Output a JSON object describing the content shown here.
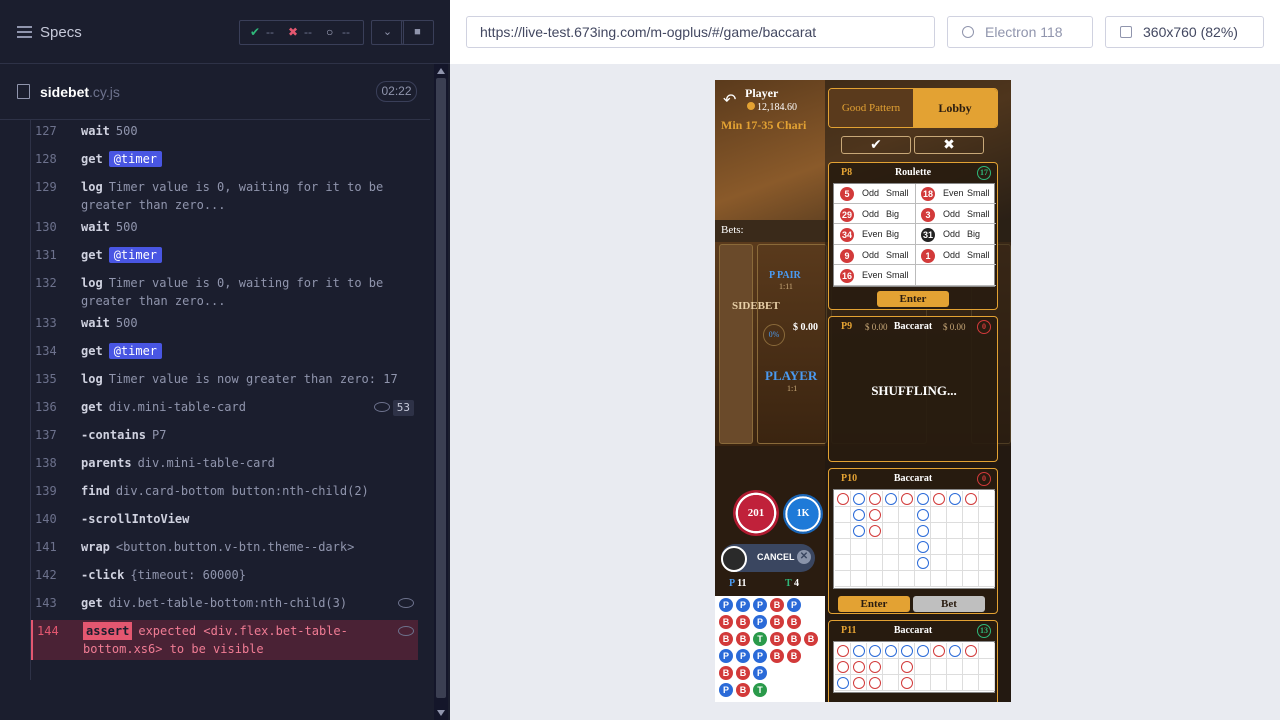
{
  "runner": {
    "specs_label": "Specs",
    "stats": {
      "passed": "--",
      "failed": "--",
      "pending": "--"
    },
    "file": {
      "name": "sidebet",
      "ext": ".cy.js",
      "duration": "02:22"
    },
    "commands": [
      {
        "num": "127",
        "name": "wait",
        "arg": "500"
      },
      {
        "num": "128",
        "name": "get",
        "alias": "@timer"
      },
      {
        "num": "129",
        "name": "log",
        "arg": "Timer value is 0, waiting for it to be greater than zero..."
      },
      {
        "num": "130",
        "name": "wait",
        "arg": "500"
      },
      {
        "num": "131",
        "name": "get",
        "alias": "@timer"
      },
      {
        "num": "132",
        "name": "log",
        "arg": "Timer value is 0, waiting for it to be greater than zero..."
      },
      {
        "num": "133",
        "name": "wait",
        "arg": "500"
      },
      {
        "num": "134",
        "name": "get",
        "alias": "@timer"
      },
      {
        "num": "135",
        "name": "log",
        "arg": "Timer value is now greater than zero: 17"
      },
      {
        "num": "136",
        "name": "get",
        "arg": "div.mini-table-card",
        "count": "53"
      },
      {
        "num": "137",
        "name": "-contains",
        "arg": "P7"
      },
      {
        "num": "138",
        "name": "parents",
        "arg": "div.mini-table-card"
      },
      {
        "num": "139",
        "name": "find",
        "arg": "div.card-bottom button:nth-child(2)"
      },
      {
        "num": "140",
        "name": "-scrollIntoView",
        "arg": ""
      },
      {
        "num": "141",
        "name": "wrap",
        "arg": "<button.button.v-btn.theme--dark>"
      },
      {
        "num": "142",
        "name": "-click",
        "arg": "{timeout: 60000}"
      },
      {
        "num": "143",
        "name": "get",
        "arg": "div.bet-table-bottom:nth-child(3)"
      }
    ],
    "error": {
      "num": "144",
      "badge": "assert",
      "message": "expected <div.flex.bet-table-bottom.xs6> to be visible"
    }
  },
  "browser": {
    "url": "https://live-test.673ing.com/m-ogplus/#/game/baccarat",
    "name": "Electron 118",
    "viewport": "360x760",
    "zoom": "(82%)"
  },
  "game": {
    "player_name": "Player",
    "balance": "12,184.60",
    "min_max": "Min 17-35 Chari",
    "bets_label": "Bets:",
    "sidebet_label": "SIDEBET",
    "ppair": "P PAIR",
    "ppair_odds": "1:11",
    "player_chip": "0%",
    "player_amount": "$ 0.00",
    "player_label": "PLAYER",
    "player_odds": "1:1",
    "chip1": "201",
    "chip2": "1K",
    "cancel": "CANCEL",
    "stats": {
      "p_label": "P",
      "p_count": "11",
      "t_label": "T",
      "t_count": "4"
    },
    "tabs": {
      "good": "Good Pattern",
      "lobby": "Lobby"
    },
    "card_p8": {
      "id": "P8",
      "name": "Roulette",
      "timer": "17",
      "enter": "Enter",
      "rows": [
        [
          {
            "n": "5",
            "c": "red",
            "a": "Odd",
            "b": "Small"
          },
          {
            "n": "18",
            "c": "red",
            "a": "Even",
            "b": "Small"
          }
        ],
        [
          {
            "n": "29",
            "c": "red",
            "a": "Odd",
            "b": "Big"
          },
          {
            "n": "3",
            "c": "red",
            "a": "Odd",
            "b": "Small"
          }
        ],
        [
          {
            "n": "34",
            "c": "red",
            "a": "Even",
            "b": "Big"
          },
          {
            "n": "31",
            "c": "blk",
            "a": "Odd",
            "b": "Big"
          }
        ],
        [
          {
            "n": "9",
            "c": "red",
            "a": "Odd",
            "b": "Small"
          },
          {
            "n": "1",
            "c": "red",
            "a": "Odd",
            "b": "Small"
          }
        ],
        [
          {
            "n": "16",
            "c": "red",
            "a": "Even",
            "b": "Small"
          },
          null
        ]
      ]
    },
    "card_p9": {
      "id": "P9",
      "name": "Baccarat",
      "timer": "0",
      "amount1": "$ 0.00",
      "amount2": "$ 0.00",
      "status": "SHUFFLING..."
    },
    "card_p10": {
      "id": "P10",
      "name": "Baccarat",
      "timer": "0",
      "enter": "Enter",
      "bet": "Bet"
    },
    "card_p11": {
      "id": "P11",
      "name": "Baccarat",
      "timer": "13"
    }
  }
}
